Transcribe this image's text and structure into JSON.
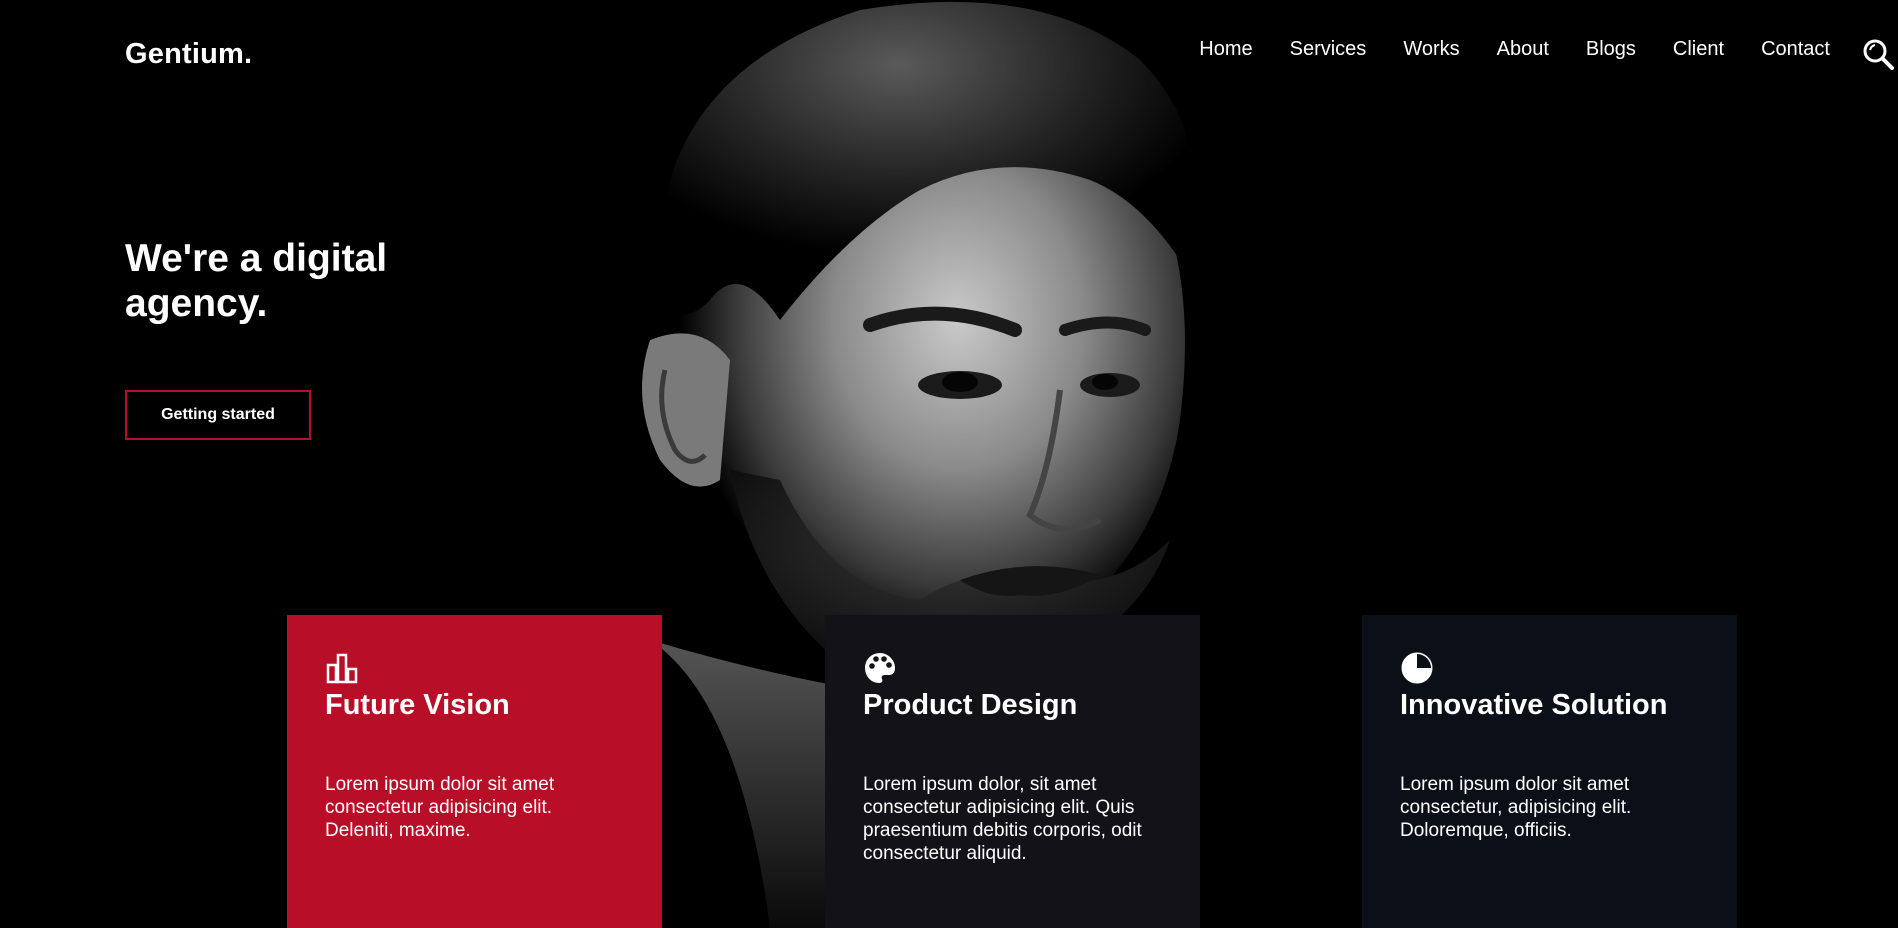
{
  "header": {
    "brand": "Gentium.",
    "nav": [
      "Home",
      "Services",
      "Works",
      "About",
      "Blogs",
      "Client",
      "Contact"
    ],
    "search_icon": "search-icon"
  },
  "hero": {
    "title": "We're a digital agency.",
    "cta_label": "Getting started",
    "image": "bearded-man-portrait-photo"
  },
  "colors": {
    "accent": "#b90e28",
    "background": "#000000",
    "card_dark_1": "#121218",
    "card_dark_2": "#0b0f17"
  },
  "features": [
    {
      "icon": "bar-chart-icon",
      "title": "Future Vision",
      "text": "Lorem ipsum dolor sit amet consectetur adipisicing elit. Deleniti, maxime."
    },
    {
      "icon": "palette-icon",
      "title": "Product Design",
      "text": "Lorem ipsum dolor, sit amet consectetur adipisicing elit. Quis praesentium debitis corporis, odit consectetur aliquid."
    },
    {
      "icon": "pie-chart-icon",
      "title": "Innovative Solution",
      "text": "Lorem ipsum dolor sit amet consectetur, adipisicing elit. Doloremque, officiis."
    }
  ]
}
